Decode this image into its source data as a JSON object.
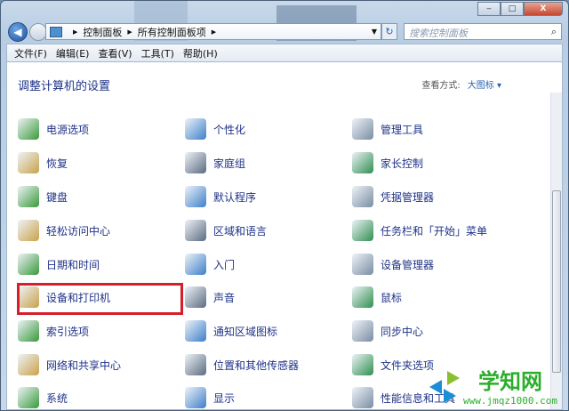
{
  "window": {
    "minimize": "‒",
    "maximize": "□",
    "close": "X"
  },
  "address": {
    "crumbs": [
      "控制面板",
      "所有控制面板项"
    ]
  },
  "search": {
    "placeholder": "搜索控制面板"
  },
  "menu": [
    "文件(F)",
    "编辑(E)",
    "查看(V)",
    "工具(T)",
    "帮助(H)"
  ],
  "header": {
    "title": "调整计算机的设置",
    "view_by_label": "查看方式:",
    "view_by_value": "大图标 ▾"
  },
  "items": [
    [
      "电源选项",
      "个性化",
      "管理工具"
    ],
    [
      "恢复",
      "家庭组",
      "家长控制"
    ],
    [
      "键盘",
      "默认程序",
      "凭据管理器"
    ],
    [
      "轻松访问中心",
      "区域和语言",
      "任务栏和「开始」菜单"
    ],
    [
      "日期和时间",
      "入门",
      "设备管理器"
    ],
    [
      "设备和打印机",
      "声音",
      "鼠标"
    ],
    [
      "索引选项",
      "通知区域图标",
      "同步中心"
    ],
    [
      "网络和共享中心",
      "位置和其他传感器",
      "文件夹选项"
    ],
    [
      "系统",
      "显示",
      "性能信息和工具"
    ]
  ],
  "selected_item": "设备和打印机",
  "icon_colors": [
    "#3a9a3a",
    "#3d7fc9",
    "#7a8da3",
    "#c9a24a",
    "#5a6b80",
    "#2f8f4f"
  ],
  "watermark": {
    "title": "学知网",
    "url": "www.jmqz1000.com"
  }
}
